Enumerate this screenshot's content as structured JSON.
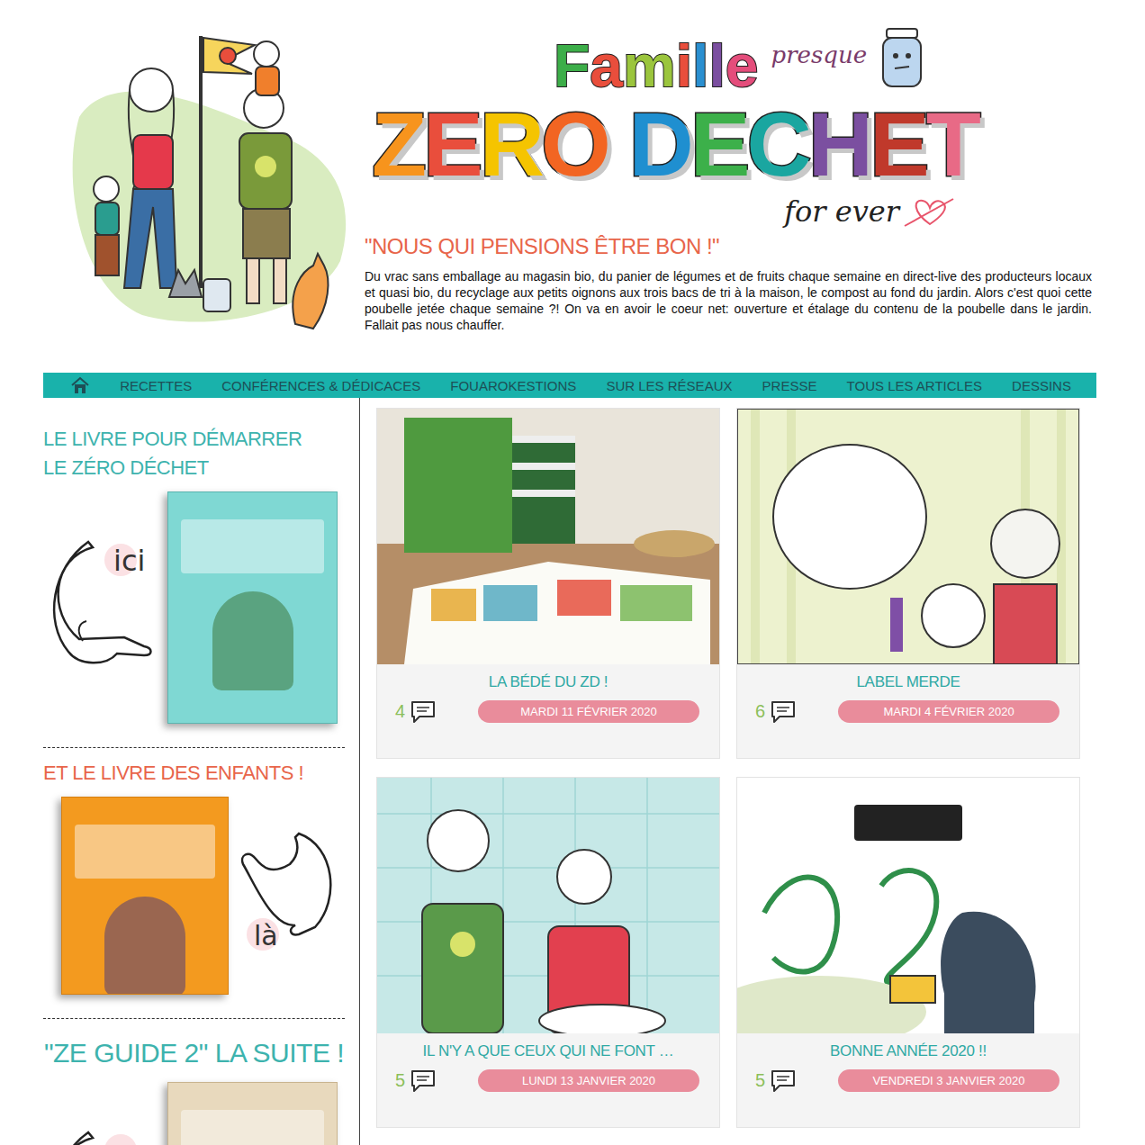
{
  "logo": {
    "family": "Famille",
    "almost": "presque",
    "name": "ZERO DECHET",
    "forever": "for ever"
  },
  "tagline": "\"NOUS QUI PENSIONS ÊTRE BON !\"",
  "intro": "Du vrac sans emballage au magasin bio, du panier de légumes et de fruits chaque semaine en direct-live des producteurs locaux et quasi bio, du recyclage aux petits oignons aux trois bacs de tri à la maison, le compost au fond du jardin. Alors c'est quoi cette poubelle jetée chaque semaine ?! On va en avoir le coeur net: ouverture et étalage du contenu de la poubelle dans le jardin. Fallait pas nous chauffer.",
  "nav": [
    "RECETTES",
    "CONFÉRENCES & DÉDICACES",
    "FOUAROKESTIONS",
    "SUR LES RÉSEAUX",
    "PRESSE",
    "TOUS LES ARTICLES",
    "DESSINS"
  ],
  "sidebar": [
    {
      "kind": "start",
      "title": [
        "LE LIVRE POUR DÉMARRER",
        "LE ZÉRO DÉCHET"
      ],
      "pointer": "ici",
      "color": "#3db3ae"
    },
    {
      "kind": "kids",
      "title": [
        "ET LE LIVRE DES ENFANTS !"
      ],
      "pointer": "là",
      "color": "#e8654a"
    },
    {
      "kind": "sequel",
      "title": [
        "\"ZE GUIDE 2\" LA SUITE !"
      ],
      "color": "#3db3ae"
    }
  ],
  "posts": [
    {
      "kind": "post",
      "title": "LA BÉDÉ DU ZD !",
      "comments": "4",
      "date": "MARDI 11 FÉVRIER 2020"
    },
    {
      "kind": "post",
      "title": "LABEL MERDE",
      "comments": "6",
      "date": "MARDI 4 FÉVRIER 2020"
    },
    {
      "kind": "post",
      "title": "IL N'Y A QUE CEUX QUI NE FONT …",
      "comments": "5",
      "date": "LUNDI 13 JANVIER 2020"
    },
    {
      "kind": "post",
      "title": "BONNE ANNÉE 2020 !!",
      "comments": "5",
      "date": "VENDREDI 3 JANVIER 2020"
    },
    {
      "kind": "cut"
    },
    {
      "kind": "cut"
    }
  ]
}
